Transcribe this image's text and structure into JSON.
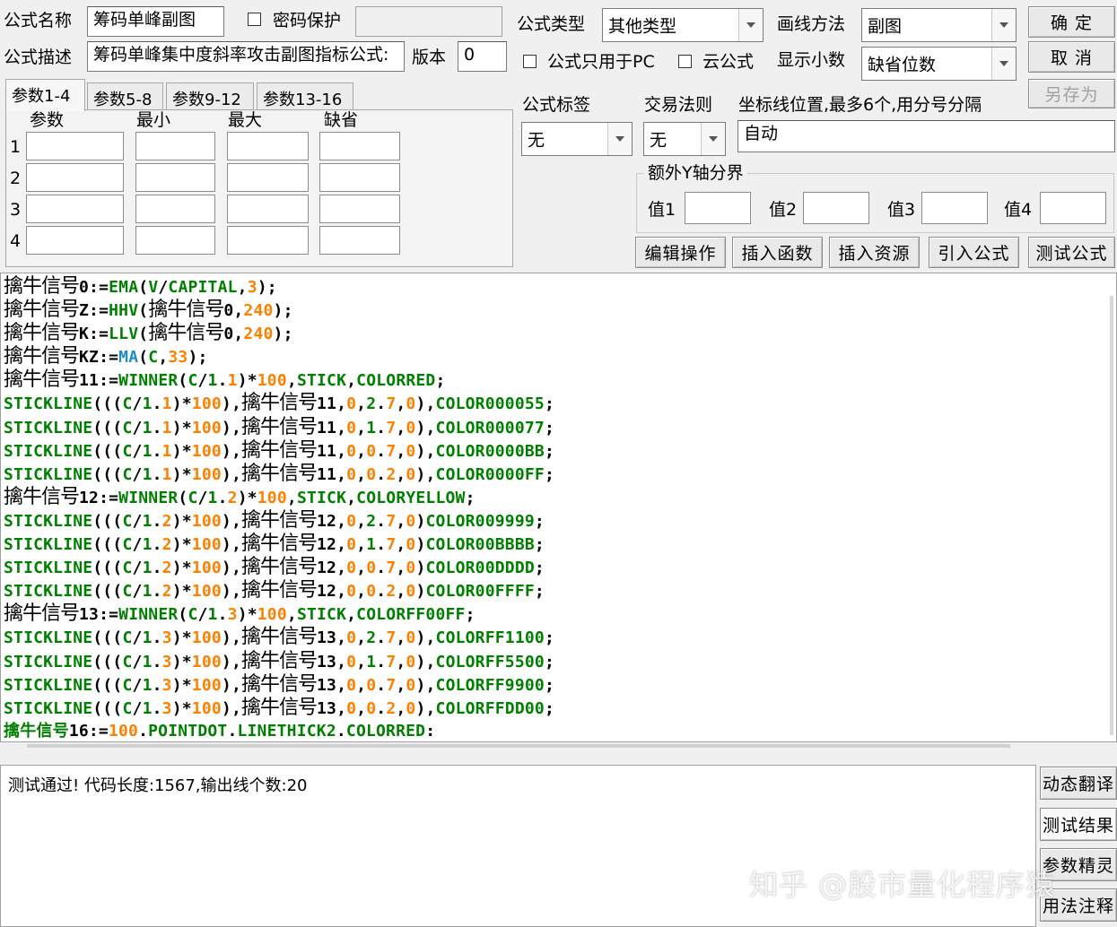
{
  "form": {
    "name_label": "公式名称",
    "name_value": "筹码单峰副图",
    "password_label": "密码保护",
    "password_value": "",
    "desc_label": "公式描述",
    "desc_value": "筹码单峰集中度斜率攻击副图指标公式:",
    "version_label": "版本",
    "version_value": "0",
    "type_label": "公式类型",
    "type_value": "其他类型",
    "draw_label": "画线方法",
    "draw_value": "副图",
    "pc_only_label": "公式只用于PC",
    "cloud_label": "云公式",
    "decimal_label": "显示小数",
    "decimal_value": "缺省位数",
    "tag_label": "公式标签",
    "tag_value": "无",
    "rule_label": "交易法则",
    "rule_value": "无",
    "coord_label": "坐标线位置,最多6个,用分号分隔",
    "coord_value": "自动",
    "yaxis_group_label": "额外Y轴分界",
    "y_values": [
      "值1",
      "值2",
      "值3",
      "值4"
    ]
  },
  "buttons": {
    "ok": "确 定",
    "cancel": "取 消",
    "save_as": "另存为",
    "edit_ops": "编辑操作",
    "insert_func": "插入函数",
    "insert_res": "插入资源",
    "import_formula": "引入公式",
    "test_formula": "测试公式",
    "dynamic_translate": "动态翻译",
    "test_result": "测试结果",
    "param_wizard": "参数精灵",
    "usage_notes": "用法注释"
  },
  "tabs": [
    "参数1-4",
    "参数5-8",
    "参数9-12",
    "参数13-16"
  ],
  "params": {
    "headers": [
      "参数",
      "最小",
      "最大",
      "缺省"
    ],
    "rows": [
      "1",
      "2",
      "3",
      "4"
    ]
  },
  "code_lines": [
    [
      [
        "v",
        "擒牛信号"
      ],
      [
        "o",
        "0:="
      ],
      [
        "f",
        "EMA"
      ],
      [
        "o",
        "("
      ],
      [
        "f",
        "V"
      ],
      [
        "o",
        "/"
      ],
      [
        "f",
        "CAPITAL"
      ],
      [
        "o",
        ","
      ],
      [
        "n",
        "3"
      ],
      [
        "o",
        ");"
      ]
    ],
    [
      [
        "v",
        "擒牛信号"
      ],
      [
        "o",
        "Z:="
      ],
      [
        "f",
        "HHV"
      ],
      [
        "o",
        "("
      ],
      [
        "v",
        "擒牛信号"
      ],
      [
        "o",
        "0,"
      ],
      [
        "n",
        "240"
      ],
      [
        "o",
        ");"
      ]
    ],
    [
      [
        "v",
        "擒牛信号"
      ],
      [
        "o",
        "K:="
      ],
      [
        "f",
        "LLV"
      ],
      [
        "o",
        "("
      ],
      [
        "v",
        "擒牛信号"
      ],
      [
        "o",
        "0,"
      ],
      [
        "n",
        "240"
      ],
      [
        "o",
        ");"
      ]
    ],
    [
      [
        "v",
        "擒牛信号"
      ],
      [
        "o",
        "KZ:="
      ],
      [
        "b",
        "MA"
      ],
      [
        "o",
        "("
      ],
      [
        "f",
        "C"
      ],
      [
        "o",
        ","
      ],
      [
        "n",
        "33"
      ],
      [
        "o",
        ");"
      ]
    ],
    [
      [
        "v",
        "擒牛信号"
      ],
      [
        "o",
        "11:="
      ],
      [
        "f",
        "WINNER"
      ],
      [
        "o",
        "("
      ],
      [
        "f",
        "C"
      ],
      [
        "o",
        "/"
      ],
      [
        "f",
        "1"
      ],
      [
        "o",
        "."
      ],
      [
        "n",
        "1"
      ],
      [
        "o",
        ")*"
      ],
      [
        "n",
        "100"
      ],
      [
        "o",
        ","
      ],
      [
        "f",
        "STICK"
      ],
      [
        "o",
        ","
      ],
      [
        "f",
        "COLORRED"
      ],
      [
        "o",
        ";"
      ]
    ],
    [
      [
        "f",
        "STICKLINE"
      ],
      [
        "o",
        "((("
      ],
      [
        "f",
        "C"
      ],
      [
        "o",
        "/"
      ],
      [
        "f",
        "1"
      ],
      [
        "o",
        "."
      ],
      [
        "n",
        "1"
      ],
      [
        "o",
        ")*"
      ],
      [
        "n",
        "100"
      ],
      [
        "o",
        "),"
      ],
      [
        "v",
        "擒牛信号"
      ],
      [
        "o",
        "11,"
      ],
      [
        "n",
        "0"
      ],
      [
        "o",
        ","
      ],
      [
        "f",
        "2"
      ],
      [
        "o",
        "."
      ],
      [
        "n",
        "7"
      ],
      [
        "o",
        ","
      ],
      [
        "n",
        "0"
      ],
      [
        "o",
        "),"
      ],
      [
        "f",
        "COLOR000055"
      ],
      [
        "o",
        ";"
      ]
    ],
    [
      [
        "f",
        "STICKLINE"
      ],
      [
        "o",
        "((("
      ],
      [
        "f",
        "C"
      ],
      [
        "o",
        "/"
      ],
      [
        "f",
        "1"
      ],
      [
        "o",
        "."
      ],
      [
        "n",
        "1"
      ],
      [
        "o",
        ")*"
      ],
      [
        "n",
        "100"
      ],
      [
        "o",
        "),"
      ],
      [
        "v",
        "擒牛信号"
      ],
      [
        "o",
        "11,"
      ],
      [
        "n",
        "0"
      ],
      [
        "o",
        ","
      ],
      [
        "f",
        "1"
      ],
      [
        "o",
        "."
      ],
      [
        "n",
        "7"
      ],
      [
        "o",
        ","
      ],
      [
        "n",
        "0"
      ],
      [
        "o",
        "),"
      ],
      [
        "f",
        "COLOR000077"
      ],
      [
        "o",
        ";"
      ]
    ],
    [
      [
        "f",
        "STICKLINE"
      ],
      [
        "o",
        "((("
      ],
      [
        "f",
        "C"
      ],
      [
        "o",
        "/"
      ],
      [
        "f",
        "1"
      ],
      [
        "o",
        "."
      ],
      [
        "n",
        "1"
      ],
      [
        "o",
        ")*"
      ],
      [
        "n",
        "100"
      ],
      [
        "o",
        "),"
      ],
      [
        "v",
        "擒牛信号"
      ],
      [
        "o",
        "11,"
      ],
      [
        "n",
        "0"
      ],
      [
        "o",
        ","
      ],
      [
        "n",
        "0"
      ],
      [
        "o",
        "."
      ],
      [
        "n",
        "7"
      ],
      [
        "o",
        ","
      ],
      [
        "n",
        "0"
      ],
      [
        "o",
        "),"
      ],
      [
        "f",
        "COLOR0000BB"
      ],
      [
        "o",
        ";"
      ]
    ],
    [
      [
        "f",
        "STICKLINE"
      ],
      [
        "o",
        "((("
      ],
      [
        "f",
        "C"
      ],
      [
        "o",
        "/"
      ],
      [
        "f",
        "1"
      ],
      [
        "o",
        "."
      ],
      [
        "n",
        "1"
      ],
      [
        "o",
        ")*"
      ],
      [
        "n",
        "100"
      ],
      [
        "o",
        "),"
      ],
      [
        "v",
        "擒牛信号"
      ],
      [
        "o",
        "11,"
      ],
      [
        "n",
        "0"
      ],
      [
        "o",
        ","
      ],
      [
        "n",
        "0"
      ],
      [
        "o",
        "."
      ],
      [
        "n",
        "2"
      ],
      [
        "o",
        ","
      ],
      [
        "n",
        "0"
      ],
      [
        "o",
        "),"
      ],
      [
        "f",
        "COLOR0000FF"
      ],
      [
        "o",
        ";"
      ]
    ],
    [
      [
        "v",
        "擒牛信号"
      ],
      [
        "o",
        "12:="
      ],
      [
        "f",
        "WINNER"
      ],
      [
        "o",
        "("
      ],
      [
        "f",
        "C"
      ],
      [
        "o",
        "/"
      ],
      [
        "f",
        "1"
      ],
      [
        "o",
        "."
      ],
      [
        "n",
        "2"
      ],
      [
        "o",
        ")*"
      ],
      [
        "n",
        "100"
      ],
      [
        "o",
        ","
      ],
      [
        "f",
        "STICK"
      ],
      [
        "o",
        ","
      ],
      [
        "f",
        "COLORYELLOW"
      ],
      [
        "o",
        ";"
      ]
    ],
    [
      [
        "f",
        "STICKLINE"
      ],
      [
        "o",
        "((("
      ],
      [
        "f",
        "C"
      ],
      [
        "o",
        "/"
      ],
      [
        "f",
        "1"
      ],
      [
        "o",
        "."
      ],
      [
        "n",
        "2"
      ],
      [
        "o",
        ")*"
      ],
      [
        "n",
        "100"
      ],
      [
        "o",
        "),"
      ],
      [
        "v",
        "擒牛信号"
      ],
      [
        "o",
        "12,"
      ],
      [
        "n",
        "0"
      ],
      [
        "o",
        ","
      ],
      [
        "f",
        "2"
      ],
      [
        "o",
        "."
      ],
      [
        "n",
        "7"
      ],
      [
        "o",
        ","
      ],
      [
        "n",
        "0"
      ],
      [
        "o",
        ")"
      ],
      [
        "f",
        "COLOR009999"
      ],
      [
        "o",
        ";"
      ]
    ],
    [
      [
        "f",
        "STICKLINE"
      ],
      [
        "o",
        "((("
      ],
      [
        "f",
        "C"
      ],
      [
        "o",
        "/"
      ],
      [
        "f",
        "1"
      ],
      [
        "o",
        "."
      ],
      [
        "n",
        "2"
      ],
      [
        "o",
        ")*"
      ],
      [
        "n",
        "100"
      ],
      [
        "o",
        "),"
      ],
      [
        "v",
        "擒牛信号"
      ],
      [
        "o",
        "12,"
      ],
      [
        "n",
        "0"
      ],
      [
        "o",
        ","
      ],
      [
        "f",
        "1"
      ],
      [
        "o",
        "."
      ],
      [
        "n",
        "7"
      ],
      [
        "o",
        ","
      ],
      [
        "n",
        "0"
      ],
      [
        "o",
        ")"
      ],
      [
        "f",
        "COLOR00BBBB"
      ],
      [
        "o",
        ";"
      ]
    ],
    [
      [
        "f",
        "STICKLINE"
      ],
      [
        "o",
        "((("
      ],
      [
        "f",
        "C"
      ],
      [
        "o",
        "/"
      ],
      [
        "f",
        "1"
      ],
      [
        "o",
        "."
      ],
      [
        "n",
        "2"
      ],
      [
        "o",
        ")*"
      ],
      [
        "n",
        "100"
      ],
      [
        "o",
        "),"
      ],
      [
        "v",
        "擒牛信号"
      ],
      [
        "o",
        "12,"
      ],
      [
        "n",
        "0"
      ],
      [
        "o",
        ","
      ],
      [
        "n",
        "0"
      ],
      [
        "o",
        "."
      ],
      [
        "n",
        "7"
      ],
      [
        "o",
        ","
      ],
      [
        "n",
        "0"
      ],
      [
        "o",
        ")"
      ],
      [
        "f",
        "COLOR00DDDD"
      ],
      [
        "o",
        ";"
      ]
    ],
    [
      [
        "f",
        "STICKLINE"
      ],
      [
        "o",
        "((("
      ],
      [
        "f",
        "C"
      ],
      [
        "o",
        "/"
      ],
      [
        "f",
        "1"
      ],
      [
        "o",
        "."
      ],
      [
        "n",
        "2"
      ],
      [
        "o",
        ")*"
      ],
      [
        "n",
        "100"
      ],
      [
        "o",
        "),"
      ],
      [
        "v",
        "擒牛信号"
      ],
      [
        "o",
        "12,"
      ],
      [
        "n",
        "0"
      ],
      [
        "o",
        ","
      ],
      [
        "n",
        "0"
      ],
      [
        "o",
        "."
      ],
      [
        "n",
        "2"
      ],
      [
        "o",
        ","
      ],
      [
        "n",
        "0"
      ],
      [
        "o",
        ")"
      ],
      [
        "f",
        "COLOR00FFFF"
      ],
      [
        "o",
        ";"
      ]
    ],
    [
      [
        "v",
        "擒牛信号"
      ],
      [
        "o",
        "13:="
      ],
      [
        "f",
        "WINNER"
      ],
      [
        "o",
        "("
      ],
      [
        "f",
        "C"
      ],
      [
        "o",
        "/"
      ],
      [
        "f",
        "1"
      ],
      [
        "o",
        "."
      ],
      [
        "n",
        "3"
      ],
      [
        "o",
        ")*"
      ],
      [
        "n",
        "100"
      ],
      [
        "o",
        ","
      ],
      [
        "f",
        "STICK"
      ],
      [
        "o",
        ","
      ],
      [
        "f",
        "COLORFF00FF"
      ],
      [
        "o",
        ";"
      ]
    ],
    [
      [
        "f",
        "STICKLINE"
      ],
      [
        "o",
        "((("
      ],
      [
        "f",
        "C"
      ],
      [
        "o",
        "/"
      ],
      [
        "f",
        "1"
      ],
      [
        "o",
        "."
      ],
      [
        "n",
        "3"
      ],
      [
        "o",
        ")*"
      ],
      [
        "n",
        "100"
      ],
      [
        "o",
        "),"
      ],
      [
        "v",
        "擒牛信号"
      ],
      [
        "o",
        "13,"
      ],
      [
        "n",
        "0"
      ],
      [
        "o",
        ","
      ],
      [
        "f",
        "2"
      ],
      [
        "o",
        "."
      ],
      [
        "n",
        "7"
      ],
      [
        "o",
        ","
      ],
      [
        "n",
        "0"
      ],
      [
        "o",
        "),"
      ],
      [
        "f",
        "COLORFF1100"
      ],
      [
        "o",
        ";"
      ]
    ],
    [
      [
        "f",
        "STICKLINE"
      ],
      [
        "o",
        "((("
      ],
      [
        "f",
        "C"
      ],
      [
        "o",
        "/"
      ],
      [
        "f",
        "1"
      ],
      [
        "o",
        "."
      ],
      [
        "n",
        "3"
      ],
      [
        "o",
        ")*"
      ],
      [
        "n",
        "100"
      ],
      [
        "o",
        "),"
      ],
      [
        "v",
        "擒牛信号"
      ],
      [
        "o",
        "13,"
      ],
      [
        "n",
        "0"
      ],
      [
        "o",
        ","
      ],
      [
        "f",
        "1"
      ],
      [
        "o",
        "."
      ],
      [
        "n",
        "7"
      ],
      [
        "o",
        ","
      ],
      [
        "n",
        "0"
      ],
      [
        "o",
        "),"
      ],
      [
        "f",
        "COLORFF5500"
      ],
      [
        "o",
        ";"
      ]
    ],
    [
      [
        "f",
        "STICKLINE"
      ],
      [
        "o",
        "((("
      ],
      [
        "f",
        "C"
      ],
      [
        "o",
        "/"
      ],
      [
        "f",
        "1"
      ],
      [
        "o",
        "."
      ],
      [
        "n",
        "3"
      ],
      [
        "o",
        ")*"
      ],
      [
        "n",
        "100"
      ],
      [
        "o",
        "),"
      ],
      [
        "v",
        "擒牛信号"
      ],
      [
        "o",
        "13,"
      ],
      [
        "n",
        "0"
      ],
      [
        "o",
        ","
      ],
      [
        "n",
        "0"
      ],
      [
        "o",
        "."
      ],
      [
        "n",
        "7"
      ],
      [
        "o",
        ","
      ],
      [
        "n",
        "0"
      ],
      [
        "o",
        "),"
      ],
      [
        "f",
        "COLORFF9900"
      ],
      [
        "o",
        ";"
      ]
    ],
    [
      [
        "f",
        "STICKLINE"
      ],
      [
        "o",
        "((("
      ],
      [
        "f",
        "C"
      ],
      [
        "o",
        "/"
      ],
      [
        "f",
        "1"
      ],
      [
        "o",
        "."
      ],
      [
        "n",
        "3"
      ],
      [
        "o",
        ")*"
      ],
      [
        "n",
        "100"
      ],
      [
        "o",
        "),"
      ],
      [
        "v",
        "擒牛信号"
      ],
      [
        "o",
        "13,"
      ],
      [
        "n",
        "0"
      ],
      [
        "o",
        ","
      ],
      [
        "n",
        "0"
      ],
      [
        "o",
        "."
      ],
      [
        "n",
        "2"
      ],
      [
        "o",
        ","
      ],
      [
        "n",
        "0"
      ],
      [
        "o",
        "),"
      ],
      [
        "f",
        "COLORFFDD00"
      ],
      [
        "o",
        ";"
      ]
    ],
    [
      [
        "f",
        "擒牛信号"
      ],
      [
        "o",
        "16:="
      ],
      [
        "n",
        "100"
      ],
      [
        "o",
        "."
      ],
      [
        "f",
        "POINTDOT"
      ],
      [
        "o",
        "."
      ],
      [
        "f",
        "LINETHICK2"
      ],
      [
        "o",
        "."
      ],
      [
        "f",
        "COLORRED"
      ],
      [
        "o",
        ":"
      ]
    ]
  ],
  "output_text": "测试通过! 代码长度:1567,输出线个数:20",
  "watermark": "知乎 @股市量化程序猿"
}
